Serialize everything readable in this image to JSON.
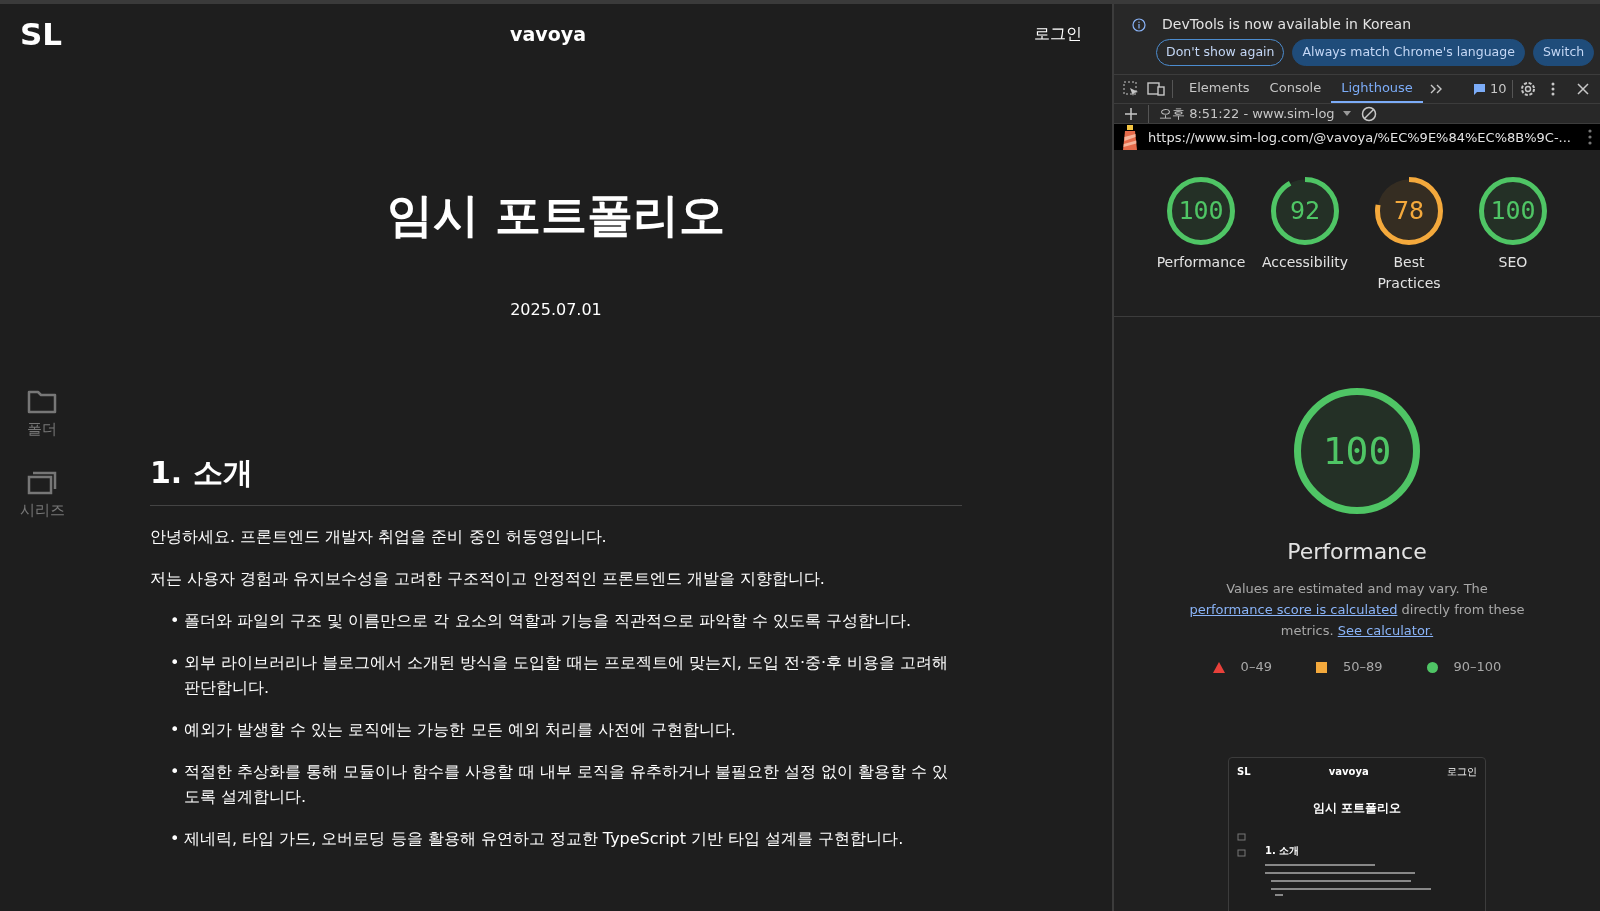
{
  "page": {
    "logo": "SL",
    "blog_name": "vavoya",
    "login": "로그인",
    "title": "임시 포트폴리오",
    "date": "2025.07.01",
    "sidebar": [
      {
        "label": "폴더",
        "kind": "folder"
      },
      {
        "label": "시리즈",
        "kind": "series"
      }
    ],
    "article": {
      "heading": "1. 소개",
      "paragraphs": [
        "안녕하세요. 프론트엔드 개발자 취업을 준비 중인 허동영입니다.",
        "저는 사용자 경험과 유지보수성을 고려한 구조적이고 안정적인 프론트엔드 개발을 지향합니다."
      ],
      "marker": "•",
      "bullets": [
        "폴더와 파일의 구조 및 이름만으로 각 요소의 역할과 기능을 직관적으로 파악할 수 있도록 구성합니다.",
        "외부 라이브러리나 블로그에서 소개된 방식을 도입할 때는 프로젝트에 맞는지, 도입 전·중·후 비용을 고려해 판단합니다.",
        "예외가 발생할 수 있는 로직에는 가능한 모든 예외 처리를 사전에 구현합니다.",
        "적절한 추상화를 통해 모듈이나 함수를 사용할 때 내부 로직을 유추하거나 불필요한 설정 없이 활용할 수 있도록 설계합니다.",
        "제네릭, 타입 가드, 오버로딩 등을 활용해 유연하고 정교한 TypeScript 기반 타입 설계를 구현합니다."
      ]
    }
  },
  "devtools": {
    "notice": {
      "text": "DevTools is now available in Korean",
      "buttons": [
        {
          "label": "Don't show again",
          "kind": "outline"
        },
        {
          "label": "Always match Chrome's language",
          "kind": "filled"
        },
        {
          "label": "Switch",
          "kind": "filled"
        }
      ]
    },
    "tabs": [
      {
        "label": "Elements",
        "selected": false
      },
      {
        "label": "Console",
        "selected": false
      },
      {
        "label": "Lighthouse",
        "selected": true
      }
    ],
    "issues_count": "10",
    "report_selector": "오후 8:51:22 - www.sim-log",
    "url": "https://www.sim-log.com/@vavoya/%EC%9E%84%EC%8B%9C-...",
    "scores": [
      {
        "value": "100",
        "label": "Performance",
        "level": 1.0,
        "color": "#4fc565"
      },
      {
        "value": "92",
        "label": "Accessibility",
        "level": 0.92,
        "color": "#4fc565"
      },
      {
        "value": "78",
        "label": "Best Practices",
        "level": 0.78,
        "color": "#f4a93c"
      },
      {
        "value": "100",
        "label": "SEO",
        "level": 1.0,
        "color": "#4fc565"
      }
    ],
    "summary": {
      "value": "100",
      "level": 1.0,
      "color": "#4fc565",
      "title": "Performance",
      "description": [
        {
          "text": "Values are estimated and may vary. The ",
          "kind": "text"
        },
        {
          "text": "performance score is calculated",
          "kind": "link"
        },
        {
          "text": " directly from these metrics. ",
          "kind": "text"
        },
        {
          "text": "See calculator.",
          "kind": "link"
        }
      ],
      "legend": [
        {
          "range": "0–49",
          "kind": "fail",
          "color": "#e8403a"
        },
        {
          "range": "50–89",
          "kind": "average",
          "color": "#f4a93c"
        },
        {
          "range": "90–100",
          "kind": "pass",
          "color": "#4fc565"
        }
      ]
    },
    "screenshot": {
      "logo": "SL",
      "blog_name": "vavoya",
      "login": "로그인",
      "title": "임시 포트폴리오",
      "heading": "1. 소개"
    }
  }
}
